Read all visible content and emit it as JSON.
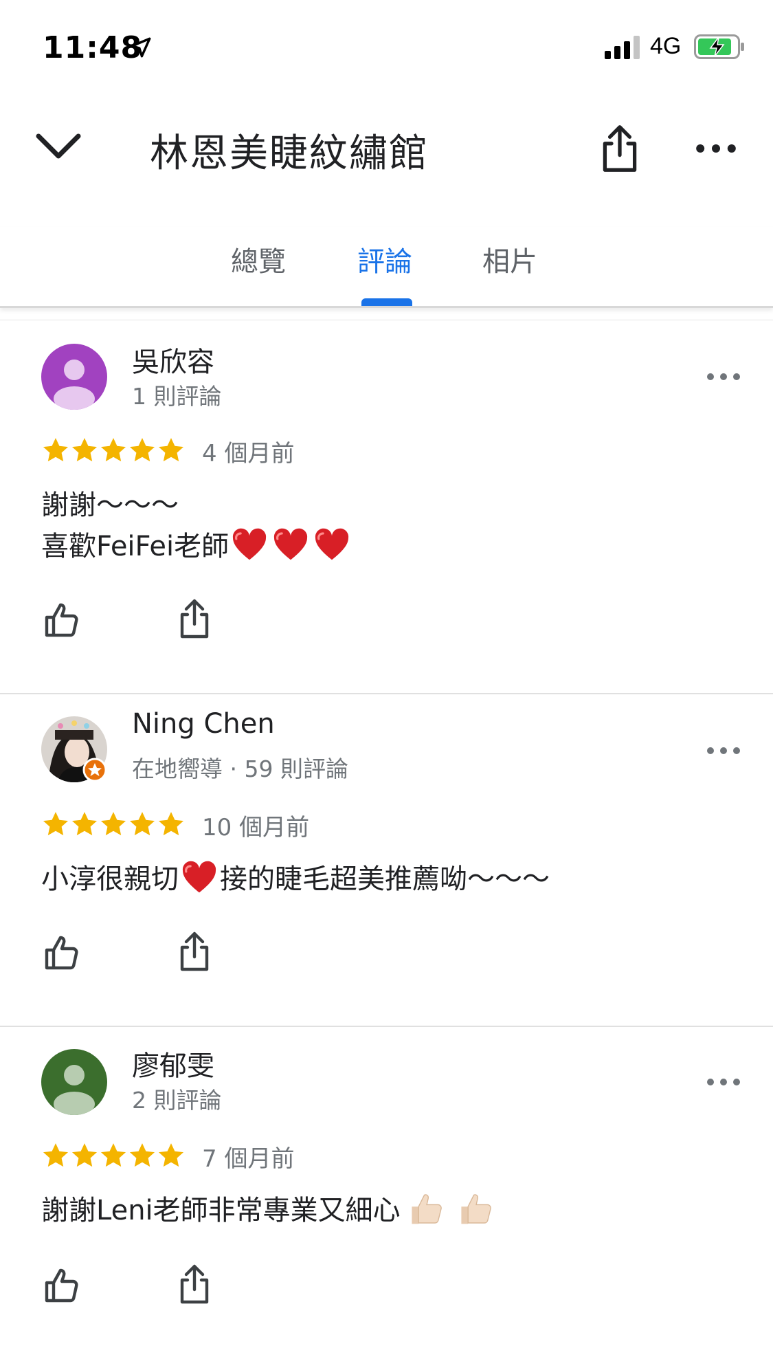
{
  "status_bar": {
    "time": "11:48",
    "network": "4G"
  },
  "header": {
    "title": "林恩美睫紋繡館"
  },
  "tabs": [
    {
      "label": "總覽"
    },
    {
      "label": "評論"
    },
    {
      "label": "相片"
    }
  ],
  "active_tab": "評論",
  "colors": {
    "accent": "#1a73e8",
    "star": "#f4b400"
  },
  "reviews": [
    {
      "name": "吳欣容",
      "meta": "1 則評論",
      "rating": 5,
      "time": "4 個月前",
      "text_lines": [
        "謝謝～～～",
        "喜歡FeiFei老師"
      ],
      "avatar_color": "#a142c0"
    },
    {
      "name": "Ning Chen",
      "meta": "在地嚮導 · 59 則評論",
      "rating": 5,
      "time": "10 個月前",
      "text_a": "小淳很親切",
      "text_b": "接的睫毛超美推薦呦～～～"
    },
    {
      "name": "廖郁雯",
      "meta": "2 則評論",
      "rating": 5,
      "time": "7 個月前",
      "text": "謝謝Leni老師非常專業又細心",
      "avatar_color": "#3b6e2d"
    }
  ]
}
